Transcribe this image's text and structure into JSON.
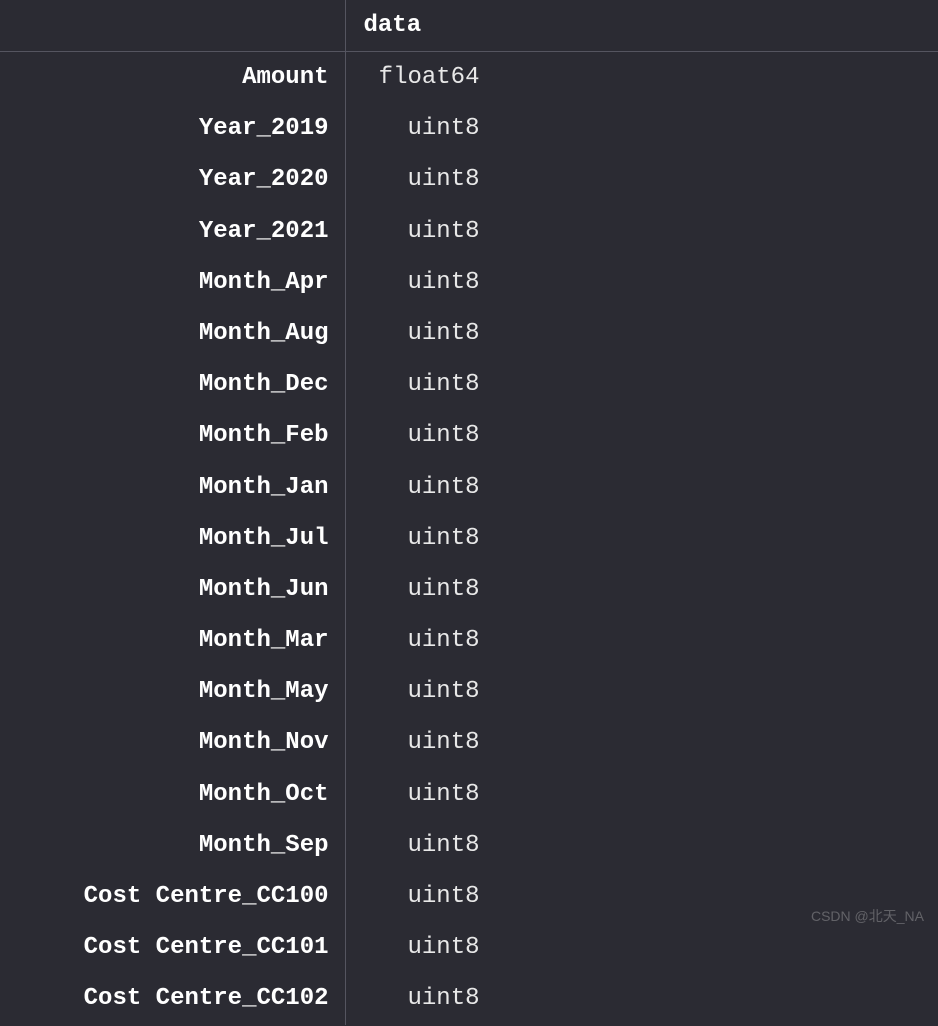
{
  "header": {
    "index_label": "",
    "column_label": "data"
  },
  "rows": [
    {
      "label": "Amount",
      "value": "float64"
    },
    {
      "label": "Year_2019",
      "value": "uint8"
    },
    {
      "label": "Year_2020",
      "value": "uint8"
    },
    {
      "label": "Year_2021",
      "value": "uint8"
    },
    {
      "label": "Month_Apr",
      "value": "uint8"
    },
    {
      "label": "Month_Aug",
      "value": "uint8"
    },
    {
      "label": "Month_Dec",
      "value": "uint8"
    },
    {
      "label": "Month_Feb",
      "value": "uint8"
    },
    {
      "label": "Month_Jan",
      "value": "uint8"
    },
    {
      "label": "Month_Jul",
      "value": "uint8"
    },
    {
      "label": "Month_Jun",
      "value": "uint8"
    },
    {
      "label": "Month_Mar",
      "value": "uint8"
    },
    {
      "label": "Month_May",
      "value": "uint8"
    },
    {
      "label": "Month_Nov",
      "value": "uint8"
    },
    {
      "label": "Month_Oct",
      "value": "uint8"
    },
    {
      "label": "Month_Sep",
      "value": "uint8"
    },
    {
      "label": "Cost Centre_CC100",
      "value": "uint8"
    },
    {
      "label": "Cost Centre_CC101",
      "value": "uint8"
    },
    {
      "label": "Cost Centre_CC102",
      "value": "uint8"
    }
  ],
  "watermark": "CSDN @北天_NA"
}
